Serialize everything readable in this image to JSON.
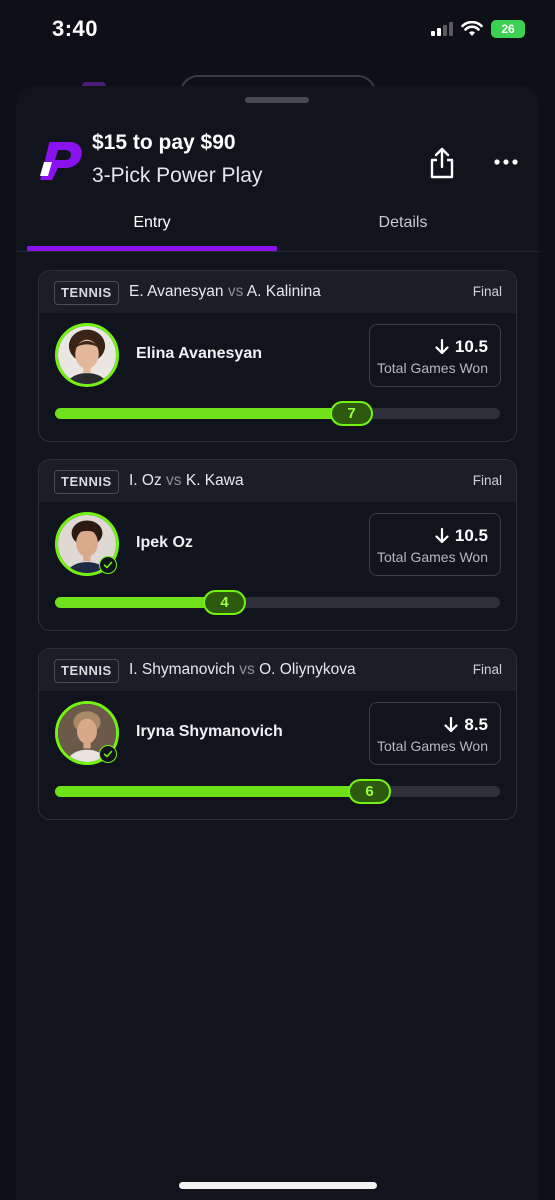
{
  "status": {
    "time": "3:40",
    "battery": "26"
  },
  "header": {
    "title": "$15 to pay $90",
    "subtitle": "3-Pick Power Play"
  },
  "tabs": [
    {
      "label": "Entry",
      "active": true
    },
    {
      "label": "Details",
      "active": false
    }
  ],
  "colors": {
    "accent_purple": "#8a12f0",
    "progress_green": "#6ee11b",
    "sheet_bg": "#11131d"
  },
  "picks": [
    {
      "sport": "TENNIS",
      "player_a": "E. Avanesyan",
      "vs": "vs",
      "player_b": "A. Kalinina",
      "status": "Final",
      "player": "Elina Avanesyan",
      "direction": "down-arrow-icon",
      "line": "10.5",
      "stat": "Total Games Won",
      "result": "7",
      "progress": 0.667,
      "checked": false
    },
    {
      "sport": "TENNIS",
      "player_a": "I. Oz",
      "vs": "vs",
      "player_b": "K. Kawa",
      "status": "Final",
      "player": "Ipek Oz",
      "direction": "down-arrow-icon",
      "line": "10.5",
      "stat": "Total Games Won",
      "result": "4",
      "progress": 0.381,
      "checked": true
    },
    {
      "sport": "TENNIS",
      "player_a": "I. Shymanovich",
      "vs": "vs",
      "player_b": "O. Oliynykova",
      "status": "Final",
      "player": "Iryna Shymanovich",
      "direction": "down-arrow-icon",
      "line": "8.5",
      "stat": "Total Games Won",
      "result": "6",
      "progress": 0.706,
      "checked": true
    }
  ]
}
